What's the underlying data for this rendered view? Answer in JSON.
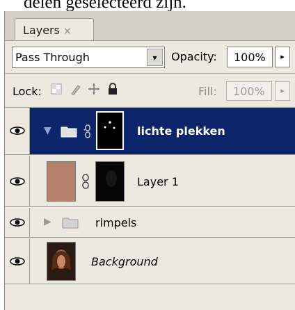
{
  "caption": "delen geselecteerd zijn.",
  "panel": {
    "tab_label": "Layers",
    "tab_close": "×"
  },
  "blending": {
    "mode": "Pass Through",
    "dropdown_glyph": "▾",
    "opacity_label": "Opacity:",
    "opacity_value": "100%",
    "opacity_arrow": "▸"
  },
  "lock": {
    "label": "Lock:",
    "icons": [
      "lock-transparency-icon",
      "lock-image-icon",
      "lock-position-icon",
      "lock-all-icon"
    ],
    "fill_label": "Fill:",
    "fill_value": "100%",
    "fill_arrow": "▸"
  },
  "layers": [
    {
      "name": "lichte plekken",
      "type": "group",
      "expanded": true,
      "selected": true,
      "has_mask": true,
      "visible": true
    },
    {
      "name": "Layer 1",
      "type": "layer",
      "selected": false,
      "has_mask": true,
      "visible": true,
      "fill_color": "#b4826a"
    },
    {
      "name": "rimpels",
      "type": "group",
      "expanded": false,
      "selected": false,
      "visible": true
    },
    {
      "name": "Background",
      "type": "background",
      "selected": false,
      "visible": true,
      "italic": true
    }
  ],
  "colors": {
    "selection": "#0b246a",
    "panel_bg": "#ece9e1",
    "layer1_swatch": "#b4826a"
  }
}
